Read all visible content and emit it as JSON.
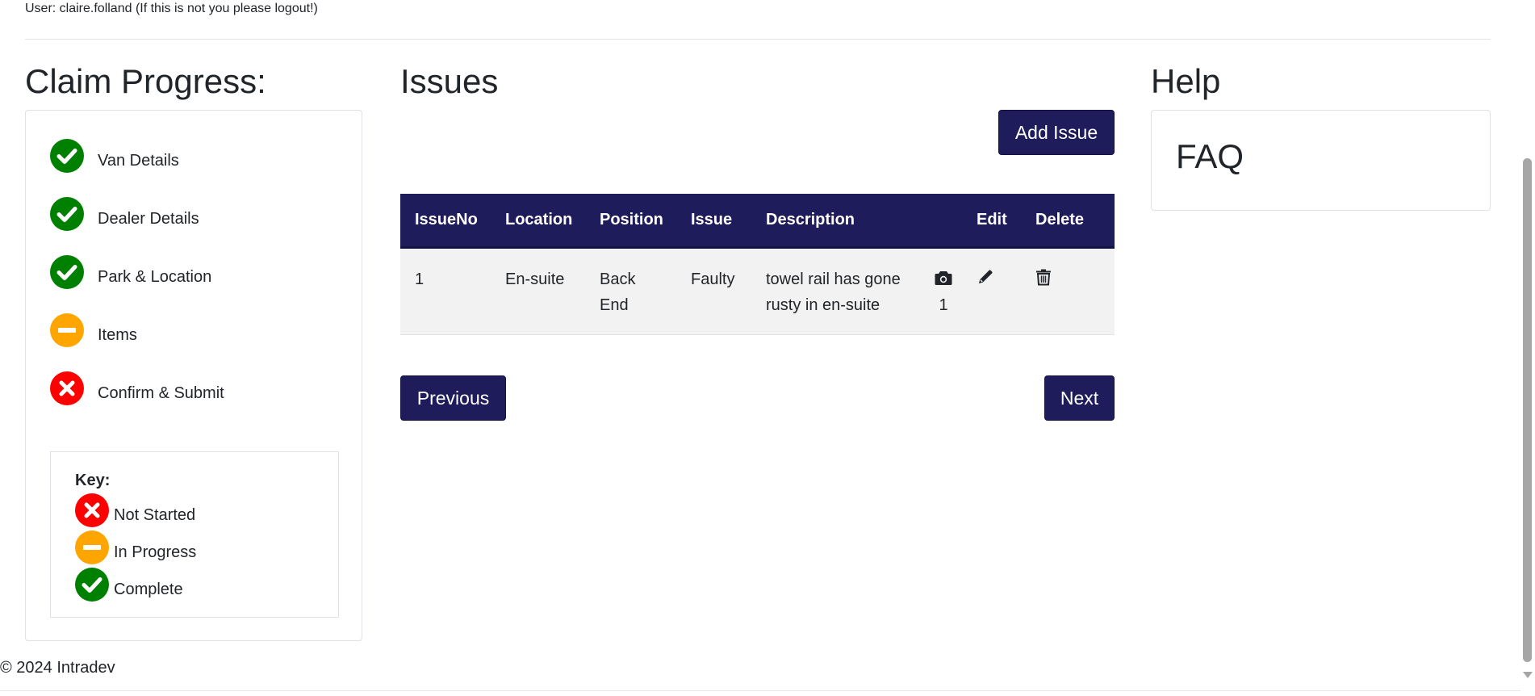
{
  "user": {
    "line": "User: claire.folland (If this is not you please logout!)"
  },
  "progress": {
    "title": "Claim Progress:",
    "steps": [
      {
        "label": "Van Details",
        "status": "complete"
      },
      {
        "label": "Dealer Details",
        "status": "complete"
      },
      {
        "label": "Park & Location",
        "status": "complete"
      },
      {
        "label": "Items",
        "status": "in-progress"
      },
      {
        "label": "Confirm & Submit",
        "status": "not-started"
      }
    ],
    "key": {
      "title": "Key:",
      "items": [
        {
          "label": "Not Started",
          "status": "not-started"
        },
        {
          "label": "In Progress",
          "status": "in-progress"
        },
        {
          "label": "Complete",
          "status": "complete"
        }
      ]
    }
  },
  "issues": {
    "title": "Issues",
    "add_label": "Add Issue",
    "columns": [
      "IssueNo",
      "Location",
      "Position",
      "Issue",
      "Description",
      "",
      "Edit",
      "Delete"
    ],
    "rows": [
      {
        "no": "1",
        "location": "En-suite",
        "position_line1": "Back",
        "position_line2": "End",
        "issue": "Faulty",
        "description_line1": "towel rail has gone",
        "description_line2": "rusty in en-suite",
        "photo_count": "1"
      }
    ],
    "previous_label": "Previous",
    "next_label": "Next"
  },
  "help": {
    "title": "Help",
    "faq": "FAQ"
  },
  "footer": {
    "text": "© 2024 Intradev"
  },
  "colors": {
    "navy": "#1e1c5a",
    "complete": "#008000",
    "in_progress": "#ffa500",
    "not_started": "#ff0000",
    "row_bg": "#f2f2f2"
  }
}
